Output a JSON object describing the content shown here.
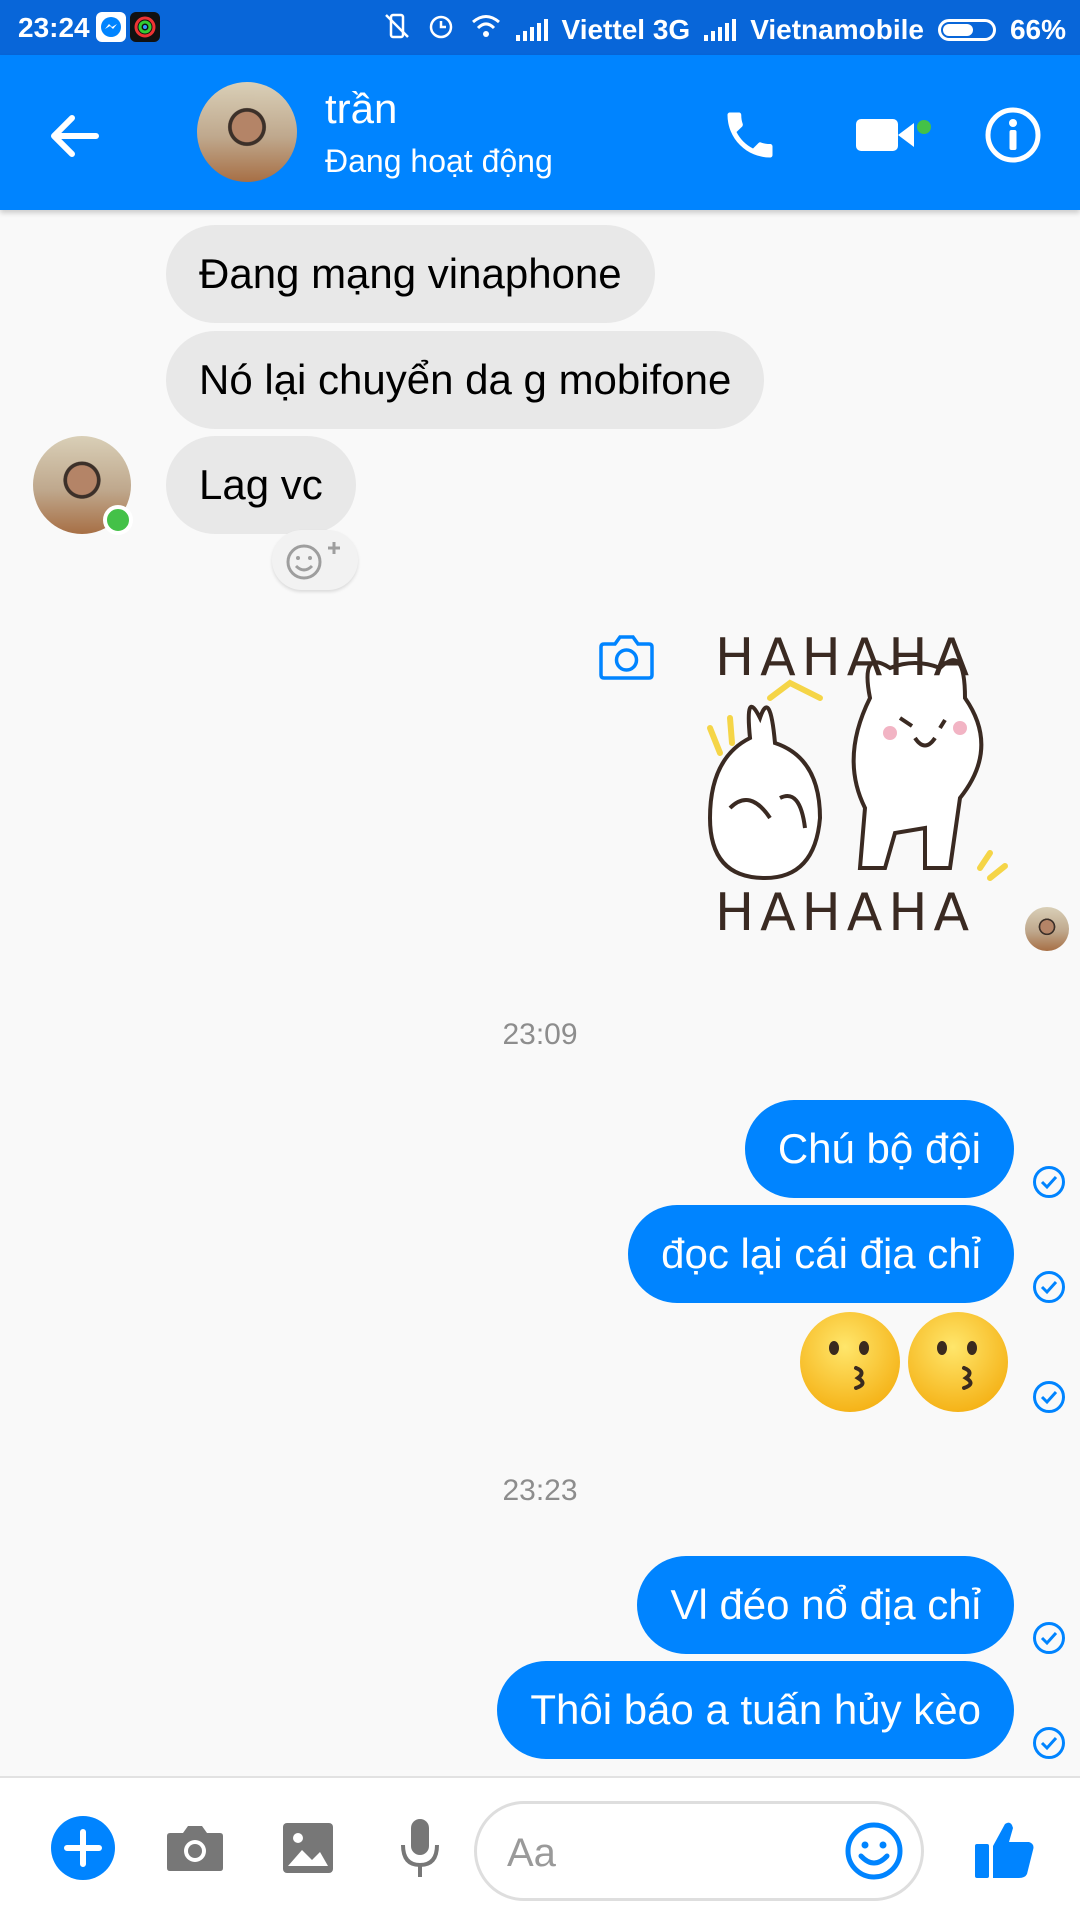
{
  "status_bar": {
    "time": "23:24",
    "carrier1": "Viettel 3G",
    "carrier2": "Vietnamobile",
    "battery": "66%",
    "battery_level": 0.66,
    "icons": [
      "messenger-icon",
      "app-icon",
      "mute-vibrate-icon",
      "alarm-icon",
      "wifi-icon",
      "signal-icon",
      "battery-icon"
    ]
  },
  "header": {
    "contact_name": "trần",
    "contact_status": "Đang hoạt động",
    "icons": [
      "back-arrow-icon",
      "phone-icon",
      "video-icon",
      "info-icon"
    ],
    "accent": "#0084ff"
  },
  "messages": {
    "incoming": [
      "Đang mạng vinaphone",
      "Nó lại chuyển da g mobifone",
      "Lag vc"
    ],
    "sticker_top_text": "HAHAHA",
    "sticker_bottom_text": "HAHAHA",
    "time_1": "23:09",
    "outgoing_1": [
      "Chú bộ đội",
      "đọc lại cái địa chỉ"
    ],
    "emoji": [
      "kissing-face",
      "kissing-face"
    ],
    "time_2": "23:23",
    "outgoing_2": [
      "Vl đéo nổ địa chỉ",
      "Thôi báo a tuấn hủy kèo"
    ]
  },
  "composer": {
    "placeholder": "Aa",
    "icons": [
      "plus-icon",
      "camera-icon",
      "gallery-icon",
      "mic-icon",
      "emoji-icon",
      "thumbs-up-icon"
    ]
  }
}
